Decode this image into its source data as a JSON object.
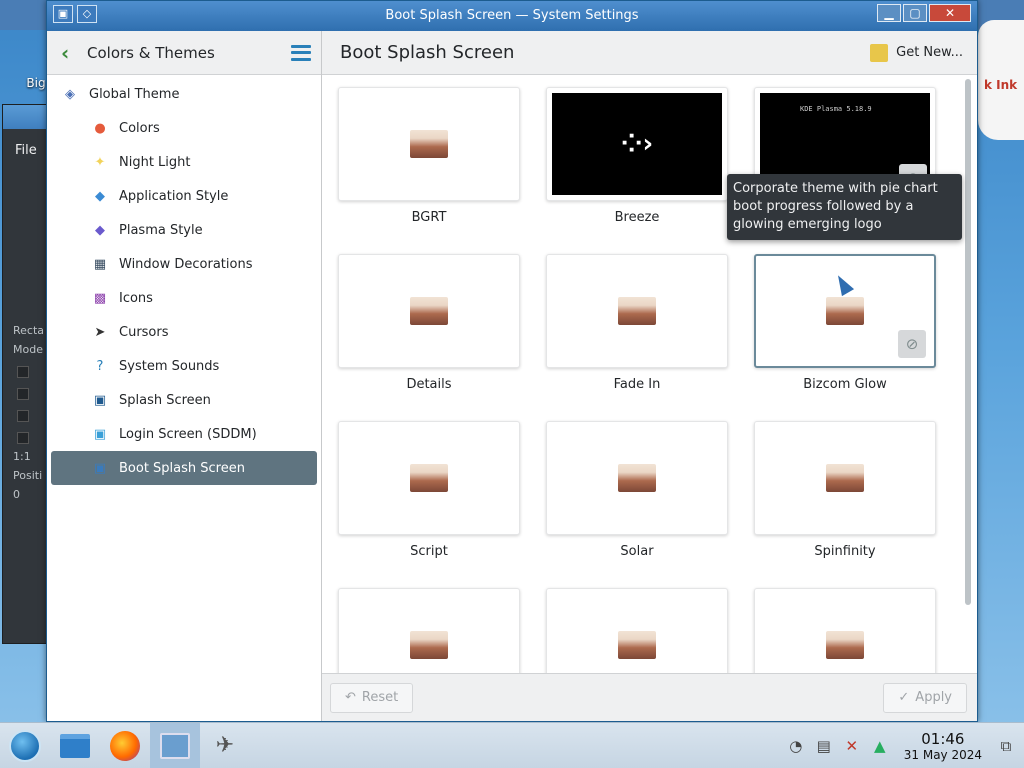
{
  "window": {
    "title": "Boot Splash Screen — System Settings"
  },
  "desktop": {
    "icon_label": "Big",
    "bg_file_menu": "File",
    "bg_texts": [
      "Recta",
      "Mode",
      "Positi",
      "1:1",
      "0"
    ],
    "right_text": "k Ink"
  },
  "sidebar": {
    "back_title": "Colors & Themes",
    "items": [
      {
        "label": "Global Theme",
        "icon": "global-theme-icon",
        "level": "top"
      },
      {
        "label": "Colors",
        "icon": "colors-icon",
        "level": "sub"
      },
      {
        "label": "Night Light",
        "icon": "night-light-icon",
        "level": "sub"
      },
      {
        "label": "Application Style",
        "icon": "application-style-icon",
        "level": "sub"
      },
      {
        "label": "Plasma Style",
        "icon": "plasma-style-icon",
        "level": "sub"
      },
      {
        "label": "Window Decorations",
        "icon": "window-decorations-icon",
        "level": "sub"
      },
      {
        "label": "Icons",
        "icon": "icons-icon",
        "level": "sub"
      },
      {
        "label": "Cursors",
        "icon": "cursors-icon",
        "level": "sub"
      },
      {
        "label": "System Sounds",
        "icon": "system-sounds-icon",
        "level": "sub"
      },
      {
        "label": "Splash Screen",
        "icon": "splash-screen-icon",
        "level": "sub"
      },
      {
        "label": "Login Screen (SDDM)",
        "icon": "login-screen-icon",
        "level": "sub"
      },
      {
        "label": "Boot Splash Screen",
        "icon": "boot-splash-icon",
        "level": "sub",
        "active": true
      }
    ]
  },
  "content": {
    "title": "Boot Splash Screen",
    "get_new": "Get New...",
    "themes": [
      {
        "name": "BGRT"
      },
      {
        "name": "Breeze",
        "preview": "breeze"
      },
      {
        "name": "Corporate",
        "preview": "plasma",
        "preview_text": "KDE Plasma 5.18.9"
      },
      {
        "name": "Details"
      },
      {
        "name": "Fade In"
      },
      {
        "name": "Bizcom Glow",
        "selected": true
      },
      {
        "name": "Script"
      },
      {
        "name": "Solar"
      },
      {
        "name": "Spinfinity"
      },
      {
        "name": ""
      },
      {
        "name": ""
      },
      {
        "name": ""
      }
    ],
    "tooltip": "Corporate theme with pie chart boot progress followed by a glowing emerging logo"
  },
  "footer": {
    "reset": "Reset",
    "apply": "Apply"
  },
  "taskbar": {
    "time": "01:46",
    "date": "31 May 2024"
  },
  "colors": {
    "accent": "#2980b9",
    "selection": "#5f7480",
    "titlebar": "#2f6faf"
  }
}
